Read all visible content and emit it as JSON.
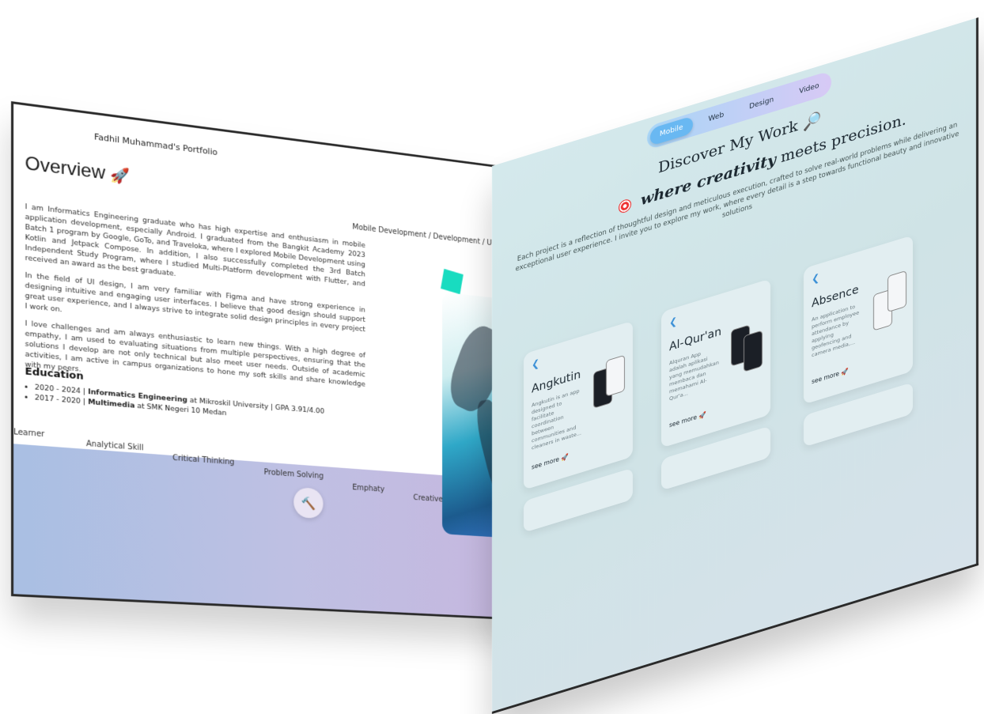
{
  "left": {
    "header": "Fadhil Muhammad's Portfolio",
    "title": "Overview",
    "title_icon": "rocket-icon",
    "breadcrumb": "Mobile Development / Development / U",
    "paragraphs": [
      "I am Informatics Engineering graduate who has high expertise and enthusiasm in mobile application development, especially Android. I graduated from the Bangkit Academy 2023 Batch 1 program by Google, GoTo, and Traveloka, where I explored Mobile Development using Kotlin and Jetpack Compose. In addition, I also successfully completed the 3rd Batch Independent Study Program, where I studied Multi-Platform development with Flutter, and received an award as the best graduate.",
      "In the field of UI design, I am very familiar with Figma and have strong experience in designing intuitive and engaging user interfaces. I believe that good design should support great user experience, and I always strive to integrate solid design principles in every project I work on.",
      "I love challenges and am always enthusiastic to learn new things. With a high degree of empathy, I am used to evaluating situations from multiple perspectives, ensuring that the solutions I develop are not only technical but also meet user needs. Outside of academic activities, I am active in campus organizations to hone my soft skills and share knowledge with my peers."
    ],
    "education_heading": "Education",
    "education": [
      {
        "years": "2020 - 2024 |",
        "degree": "Informatics Engineering",
        "rest": "at Mikroskil University | GPA 3.91/4.00"
      },
      {
        "years": "2017 - 2020 |",
        "degree": "Multimedia",
        "rest": "at SMK Negeri 10 Medan"
      }
    ],
    "skills": [
      "Learner",
      "Analytical Skill",
      "Critical Thinking",
      "Problem Solving",
      "Emphaty",
      "Creative"
    ],
    "tool_icon": "hammer-icon"
  },
  "right": {
    "tabs": [
      "Mobile",
      "Web",
      "Design",
      "Video"
    ],
    "active_tab": "Mobile",
    "title": "Discover My Work",
    "title_icon": "magnifier-icon",
    "subtitle_word": "where creativity",
    "subtitle_rest": "meets precision.",
    "description": "Each project is a reflection of thoughtful design and meticulous execution, crafted to solve real-world problems while delivering an exceptional user experience. I invite you to explore my work, where every detail is a step towards functional beauty and innovative solutions",
    "cards": [
      {
        "title": "Angkutin",
        "desc": "Angkutin is an app designed to facilitate coordination between communities and cleaners in waste...",
        "more": "see more"
      },
      {
        "title": "Al-Qur'an",
        "desc": "Alquran App adalah aplikasi yang memudahkan membaca dan memahami Al-Qur'a...",
        "more": "see more"
      },
      {
        "title": "Absence",
        "desc": "An application to perform employee attendance by applying geofencing and camera media,...",
        "more": "see more"
      }
    ]
  }
}
